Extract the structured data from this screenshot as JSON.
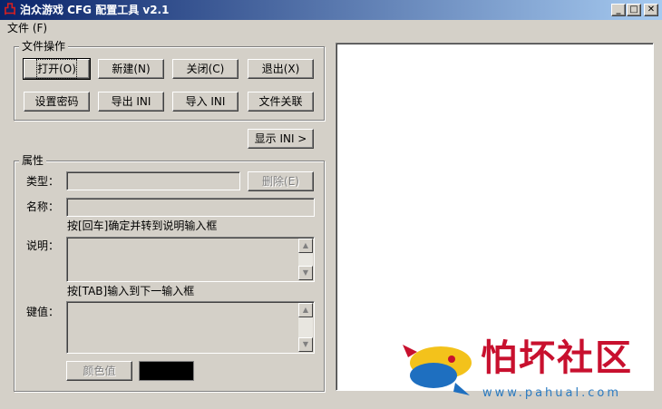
{
  "window": {
    "title": "泊众游戏 CFG 配置工具 v2.1",
    "app_icon_glyph": "凸",
    "minimize_glyph": "_",
    "maximize_glyph": "□",
    "close_glyph": "✕"
  },
  "menu": {
    "file": "文件 (F)"
  },
  "file_ops": {
    "group_title": "文件操作",
    "open": "打开(O)",
    "new": "新建(N)",
    "close": "关闭(C)",
    "exit": "退出(X)",
    "set_password": "设置密码",
    "export_ini": "导出 INI",
    "import_ini": "导入 INI",
    "file_assoc": "文件关联"
  },
  "show_ini_button": "显示 INI >",
  "props": {
    "group_title": "属性",
    "type_label": "类型：",
    "type_value": "",
    "delete_button": "删除(E)",
    "name_label": "名称：",
    "name_value": "",
    "name_hint": "按[回车]确定并转到说明输入框",
    "desc_label": "说明：",
    "desc_value": "",
    "desc_hint": "按[TAB]输入到下一输入框",
    "key_label": "键值：",
    "key_value": "",
    "color_button": "颜色值"
  },
  "colors": {
    "titlebar_start": "#0a246a",
    "titlebar_end": "#a6caf0",
    "face": "#d4d0c8",
    "swatch": "#000000"
  },
  "watermark": {
    "text": "怕坏社区",
    "url": "www.pahual.com"
  }
}
